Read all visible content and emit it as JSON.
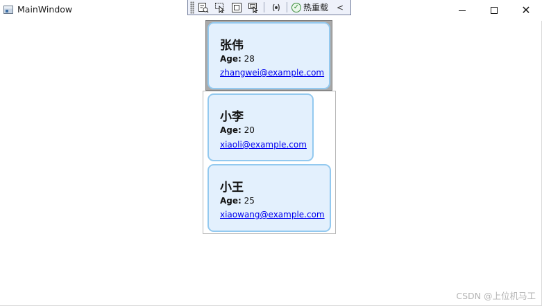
{
  "window": {
    "title": "MainWindow"
  },
  "toolbar": {
    "hot_reload_label": "热重载",
    "collapse_glyph": "<",
    "check_glyph": "✓"
  },
  "contacts": [
    {
      "name": "张伟",
      "age_label": "Age:",
      "age": "28",
      "email": "zhangwei@example.com"
    },
    {
      "name": "小李",
      "age_label": "Age:",
      "age": "20",
      "email": "xiaoli@example.com"
    },
    {
      "name": "小王",
      "age_label": "Age:",
      "age": "25",
      "email": "xiaowang@example.com"
    }
  ],
  "watermark": "CSDN @上位机马工",
  "colors": {
    "card_background": "#e3f0fd",
    "card_border": "#93c9ef",
    "link": "#0000ee",
    "selection_background": "#a9a9a9"
  }
}
